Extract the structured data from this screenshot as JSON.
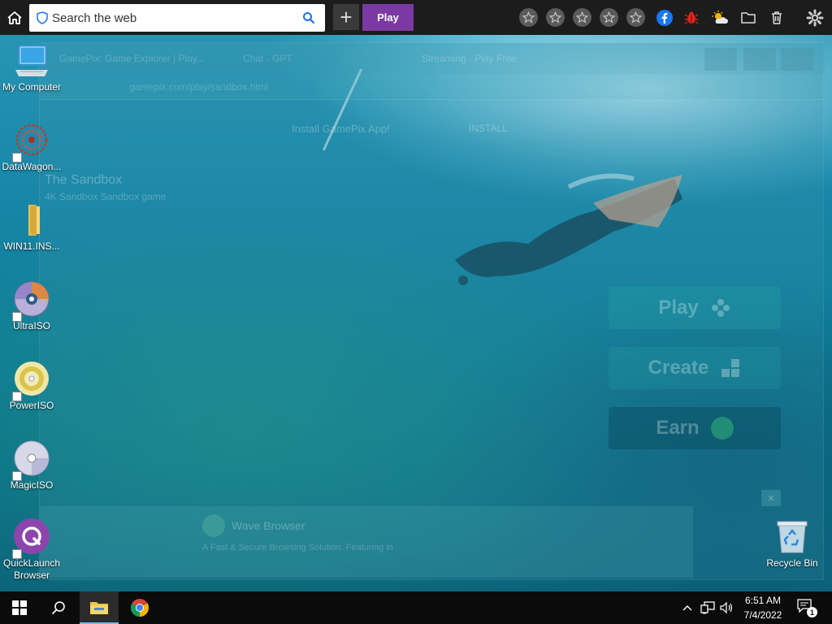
{
  "toolbar": {
    "search_placeholder": "Search the web",
    "play_label": "Play",
    "colors": {
      "background": "#1c1c1c",
      "play_button": "#7b3aa3",
      "facebook": "#1877f2",
      "bug": "#e0261b"
    }
  },
  "background_window": {
    "tabs": [
      "GamePix: Game Explorer | Play...",
      "Chat - GPT",
      "Streaming - Play Free"
    ],
    "url": "gamepix.com/play/sandbox.html",
    "install_banner": "Install GamePix App!",
    "install_button": "INSTALL",
    "game_title": "The Sandbox",
    "game_subtitle": "4K Sandbox Sandbox game",
    "buttons": {
      "play": "Play",
      "create": "Create",
      "earn": "Earn"
    },
    "notification": {
      "title": "Wave Browser",
      "body": "A Fast & Secure Browsing Solution. Featuring in"
    }
  },
  "desktop": {
    "icons": [
      {
        "label": "My Computer"
      },
      {
        "label": "DataWagon..."
      },
      {
        "label": "WIN11.INS..."
      },
      {
        "label": "UltraISO"
      },
      {
        "label": "PowerISO"
      },
      {
        "label": "MagicISO"
      },
      {
        "label": "QuickLaunch Browser"
      },
      {
        "label": "Recycle Bin"
      }
    ]
  },
  "taskbar": {
    "time": "6:51 AM",
    "date": "7/4/2022",
    "notification_count": "1"
  }
}
